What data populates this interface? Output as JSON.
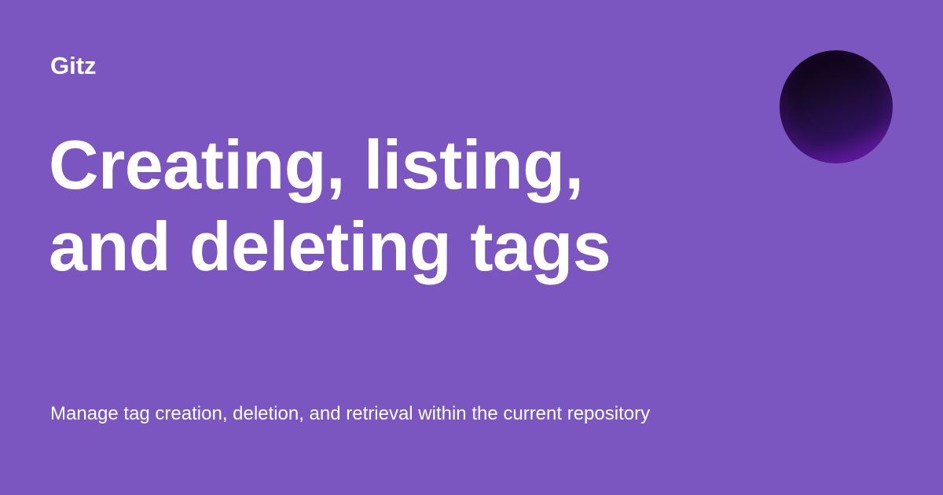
{
  "brand": {
    "name": "Gitz"
  },
  "content": {
    "title_line_1": "Creating, listing,",
    "title_line_2": "and deleting tags",
    "description": "Manage tag creation, deletion, and retrieval within the current repository"
  },
  "colors": {
    "background": "#7b56c0",
    "text": "#ffffff",
    "circle_top": "#09000a",
    "circle_bottom": "#6a1da8"
  }
}
